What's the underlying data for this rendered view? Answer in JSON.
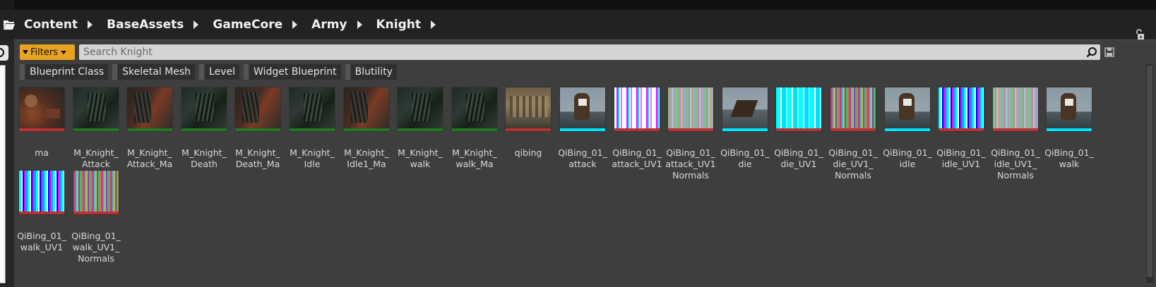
{
  "breadcrumb": {
    "items": [
      "Content",
      "BaseAssets",
      "GameCore",
      "Army",
      "Knight"
    ]
  },
  "toolbar": {
    "filters_label": "Filters",
    "search_placeholder": "Search Knight"
  },
  "filter_chips": [
    "Blueprint Class",
    "Skeletal Mesh",
    "Level",
    "Widget Blueprint",
    "Blutility"
  ],
  "colors": {
    "filters_accent": "#e9a322",
    "material_bar": "#1f7a1f",
    "texture_bar": "#b83232",
    "mesh_bar": "#00e5ff"
  },
  "assets": [
    {
      "label": "ma",
      "type": "texture",
      "thumb": "t-rust"
    },
    {
      "label": "M_Knight_\nAttack",
      "type": "material",
      "thumb": "t-dark"
    },
    {
      "label": "M_Knight_\nAttack_Ma",
      "type": "material",
      "thumb": "t-darkred"
    },
    {
      "label": "M_Knight_\nDeath",
      "type": "material",
      "thumb": "t-dark"
    },
    {
      "label": "M_Knight_\nDeath_Ma",
      "type": "material",
      "thumb": "t-darkred"
    },
    {
      "label": "M_Knight_\nIdle",
      "type": "material",
      "thumb": "t-dark"
    },
    {
      "label": "M_Knight_\nIdle1_Ma",
      "type": "material",
      "thumb": "t-darkred"
    },
    {
      "label": "M_Knight_\nwalk",
      "type": "material",
      "thumb": "t-dark"
    },
    {
      "label": "M_Knight_\nwalk_Ma",
      "type": "material",
      "thumb": "t-dark"
    },
    {
      "label": "qibing",
      "type": "texture",
      "thumb": "t-ship"
    },
    {
      "label": "QiBing_01_\nattack",
      "type": "mesh",
      "thumb": "t-horse"
    },
    {
      "label": "QiBing_01_\nattack_UV1",
      "type": "texture",
      "thumb": "t-stripes-mag"
    },
    {
      "label": "QiBing_01_\nattack_UV1\nNormals",
      "type": "texture",
      "thumb": "t-stripes-mix"
    },
    {
      "label": "QiBing_01_\ndie",
      "type": "mesh",
      "thumb": "t-horse2"
    },
    {
      "label": "QiBing_01_\ndie_UV1",
      "type": "texture",
      "thumb": "t-stripes-cyan"
    },
    {
      "label": "QiBing_01_\ndie_UV1_\nNormals",
      "type": "texture",
      "thumb": "t-stripes-rainbow"
    },
    {
      "label": "QiBing_01_\nidle",
      "type": "mesh",
      "thumb": "t-horse"
    },
    {
      "label": "QiBing_01_\nidle_UV1",
      "type": "texture",
      "thumb": "t-stripes-cyan2"
    },
    {
      "label": "QiBing_01_\nidle_UV1_\nNormals",
      "type": "texture",
      "thumb": "t-stripes-mix"
    },
    {
      "label": "QiBing_01_\nwalk",
      "type": "mesh",
      "thumb": "t-horse"
    },
    {
      "label": "QiBing_01_\nwalk_UV1",
      "type": "texture",
      "thumb": "t-stripes-cyan2"
    },
    {
      "label": "QiBing_01_\nwalk_UV1_\nNormals",
      "type": "texture",
      "thumb": "t-stripes-rainbow"
    }
  ]
}
